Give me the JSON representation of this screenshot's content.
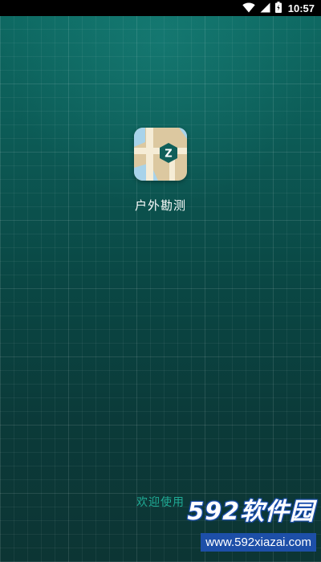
{
  "status_bar": {
    "time": "10:57",
    "icons": [
      "wifi-icon",
      "signal-icon",
      "battery-icon"
    ]
  },
  "app": {
    "name": "户外勘测",
    "icon_letter": "Z"
  },
  "welcome_text": "欢迎使用",
  "watermark": {
    "logo_text": "592软件园",
    "url": "www.592xiazai.com"
  },
  "colors": {
    "background_top": "#0e6b64",
    "background_bottom": "#0c3534",
    "accent_text": "#1faa94",
    "watermark_blue": "#1d4fa8"
  }
}
